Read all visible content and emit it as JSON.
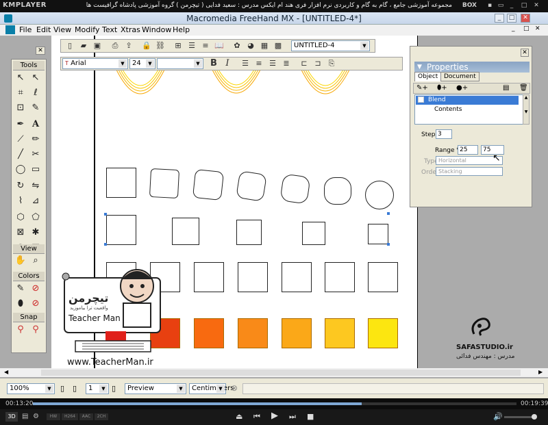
{
  "kmplayer": {
    "logo": "KMPLAYER",
    "title": "مجموعه آموزشی جامع ، گام به گام و کاربردی نرم افزار فری هند ام ایکس   مدرس : سعید فدایی ( تیچرمن ) گروه آموزشی پادشاه گرافیست ها",
    "box_label": "BOX",
    "time_elapsed": "00:13:20",
    "time_total": "00:19:39",
    "progress_fraction": 0.68,
    "badges": [
      "3D",
      "HW",
      "H264",
      "AAC",
      "2CH"
    ]
  },
  "app": {
    "title": "Macromedia FreeHand MX - [UNTITLED-4*]",
    "menu": [
      "File",
      "Edit",
      "View",
      "Modify",
      "Text",
      "Xtras",
      "Window",
      "Help"
    ]
  },
  "toolbar": {
    "document_select": "UNTITLED-4",
    "font_name": "Arial",
    "font_size": "24",
    "format_buttons": [
      "B",
      "I"
    ]
  },
  "tools_panel": {
    "sections": [
      "Tools",
      "View",
      "Colors",
      "Snap"
    ]
  },
  "properties": {
    "title": "Properties",
    "tabs": [
      "Object",
      "Document"
    ],
    "tree": [
      "Blend",
      "Contents"
    ],
    "steps_label": "Steps:",
    "steps_value": "3",
    "range_label": "Range %:",
    "range_from": "25",
    "range_to": "75",
    "type_label": "Type:",
    "type_value": "Horizontal",
    "order_label": "Order:",
    "order_value": "Stacking"
  },
  "status": {
    "zoom": "100%",
    "page": "1",
    "view_mode": "Preview",
    "units": "Centimeters"
  },
  "watermark": {
    "brand_fa": "تیچرمن",
    "brand_sub_fa": "واقعیت ترا بیاموزید",
    "brand_en": "Teacher Man",
    "url": "www.TeacherMan.ir",
    "studio": "SAFASTUDIO.ir",
    "teacher_fa": "مدرس : مهندس فدائی"
  },
  "colors": {
    "orange_swatches": [
      "#e84010",
      "#f86a10",
      "#f98a18",
      "#fba818",
      "#fdc820",
      "#fce610"
    ],
    "accent_blue": "#3a7bd5"
  }
}
